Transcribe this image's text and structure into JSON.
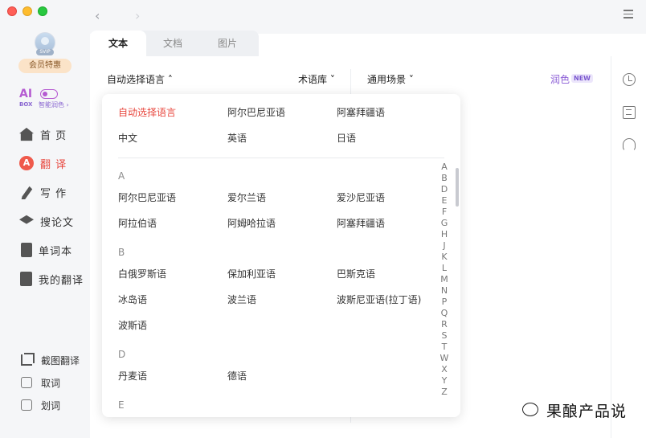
{
  "window": {
    "menu_icon": "hamburger-icon"
  },
  "sidebar": {
    "vip_badge": "SVIP",
    "vip_button": "会员特惠",
    "aibox": {
      "logo": "AI",
      "box": "BOX",
      "subtitle": "智能润色 ›"
    },
    "nav": [
      {
        "label": "首 页",
        "icon": "home-icon"
      },
      {
        "label": "翻 译",
        "icon": "translate-icon",
        "active": true
      },
      {
        "label": "写 作",
        "icon": "write-icon"
      },
      {
        "label": "搜论文",
        "icon": "paper-icon"
      },
      {
        "label": "单词本",
        "icon": "book-icon"
      },
      {
        "label": "我的翻译",
        "icon": "my-translation-icon"
      }
    ],
    "tools": [
      {
        "label": "截图翻译",
        "icon": "crop-icon"
      },
      {
        "label": "取词"
      },
      {
        "label": "划词"
      }
    ]
  },
  "tabs": [
    "文本",
    "文档",
    "图片"
  ],
  "toolbar": {
    "source_language": "自动选择语言",
    "glossary": "术语库",
    "scene": "通用场景",
    "polish": "润色",
    "new_badge": "NEW"
  },
  "dropdown": {
    "top": [
      "自动选择语言",
      "阿尔巴尼亚语",
      "阿塞拜疆语",
      "中文",
      "英语",
      "日语"
    ],
    "sections": [
      {
        "letter": "A",
        "items": [
          "阿尔巴尼亚语",
          "爱尔兰语",
          "爱沙尼亚语",
          "阿拉伯语",
          "阿姆哈拉语",
          "阿塞拜疆语"
        ]
      },
      {
        "letter": "B",
        "items": [
          "白俄罗斯语",
          "保加利亚语",
          "巴斯克语",
          "冰岛语",
          "波兰语",
          "波斯尼亚语(拉丁语)",
          "波斯语"
        ]
      },
      {
        "letter": "D",
        "items": [
          "丹麦语",
          "德语"
        ]
      },
      {
        "letter": "E",
        "items": []
      }
    ],
    "alphabet": [
      "A",
      "B",
      "D",
      "E",
      "F",
      "G",
      "H",
      "J",
      "K",
      "L",
      "M",
      "N",
      "P",
      "Q",
      "R",
      "S",
      "T",
      "W",
      "X",
      "Y",
      "Z"
    ]
  },
  "watermark": "果酿产品说"
}
